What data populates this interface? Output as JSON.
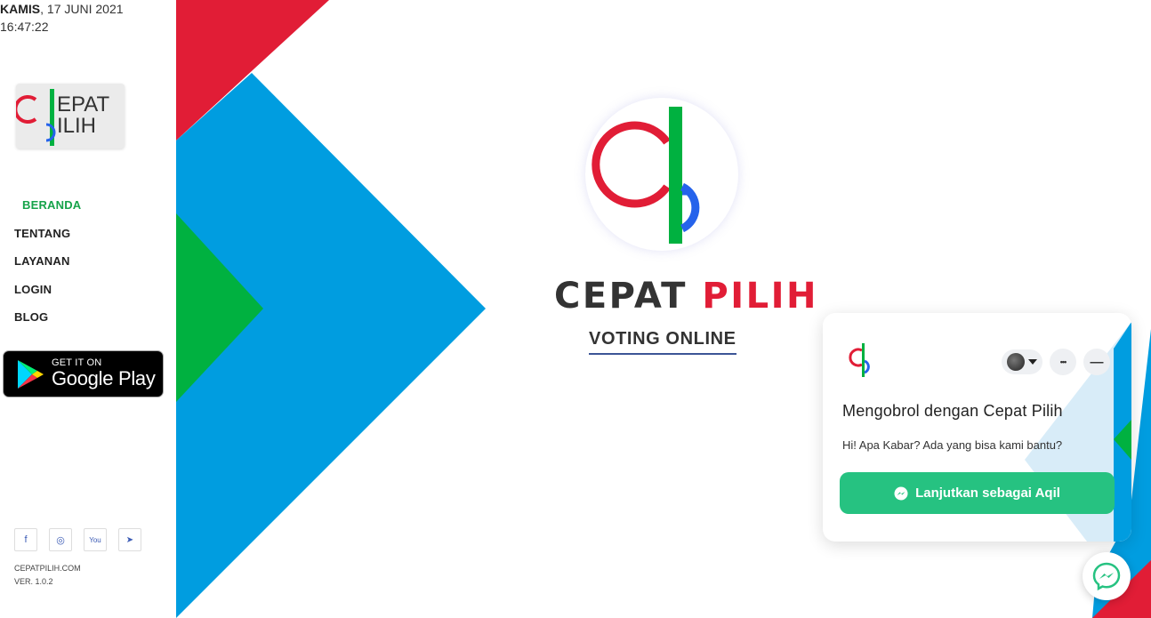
{
  "header": {
    "day": "KAMIS",
    "date": ", 17 JUNI 2021",
    "time": "16:47:22"
  },
  "logo": {
    "line1": "EPAT",
    "line2": "ILIH"
  },
  "nav": {
    "items": [
      {
        "label": "BERANDA",
        "active": true
      },
      {
        "label": "TENTANG"
      },
      {
        "label": "LAYANAN"
      },
      {
        "label": "LOGIN"
      },
      {
        "label": "BLOG"
      }
    ]
  },
  "google_play": {
    "small": "GET IT ON",
    "big": "Google Play"
  },
  "socials": [
    {
      "icon": "facebook-icon",
      "glyph": "f"
    },
    {
      "icon": "instagram-icon",
      "glyph": "◎"
    },
    {
      "icon": "youtube-icon",
      "glyph": "You"
    },
    {
      "icon": "telegram-icon",
      "glyph": "➤"
    }
  ],
  "footer": {
    "site": "CEPATPILIH.COM",
    "version": "VER. 1.0.2"
  },
  "hero": {
    "title_dark": "CEPAT ",
    "title_red": "PILIH",
    "subtitle": "VOTING ONLINE"
  },
  "chat": {
    "title": "Mengobrol dengan Cepat Pilih",
    "message": "Hi! Apa Kabar? Ada yang bisa kami bantu?",
    "button": "Lanjutkan sebagai Aqil",
    "more": "•••",
    "minimize": "—"
  },
  "colors": {
    "brand_red": "#e11d36",
    "brand_blue": "#009de0",
    "brand_green": "#00b140",
    "nav_active": "#16a34a",
    "chat_button": "#26c281"
  }
}
